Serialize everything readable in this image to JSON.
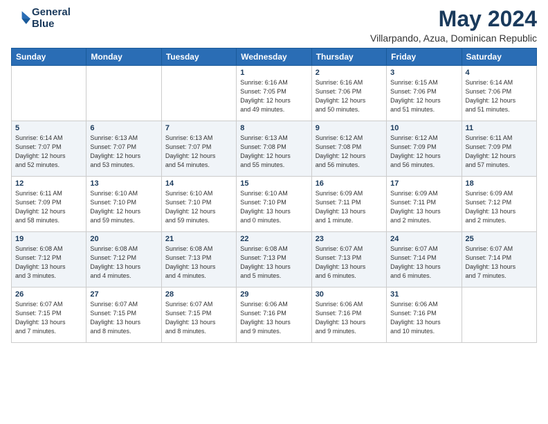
{
  "header": {
    "logo_line1": "General",
    "logo_line2": "Blue",
    "title": "May 2024",
    "subtitle": "Villarpando, Azua, Dominican Republic"
  },
  "weekdays": [
    "Sunday",
    "Monday",
    "Tuesday",
    "Wednesday",
    "Thursday",
    "Friday",
    "Saturday"
  ],
  "weeks": [
    [
      {
        "day": "",
        "info": ""
      },
      {
        "day": "",
        "info": ""
      },
      {
        "day": "",
        "info": ""
      },
      {
        "day": "1",
        "info": "Sunrise: 6:16 AM\nSunset: 7:05 PM\nDaylight: 12 hours\nand 49 minutes."
      },
      {
        "day": "2",
        "info": "Sunrise: 6:16 AM\nSunset: 7:06 PM\nDaylight: 12 hours\nand 50 minutes."
      },
      {
        "day": "3",
        "info": "Sunrise: 6:15 AM\nSunset: 7:06 PM\nDaylight: 12 hours\nand 51 minutes."
      },
      {
        "day": "4",
        "info": "Sunrise: 6:14 AM\nSunset: 7:06 PM\nDaylight: 12 hours\nand 51 minutes."
      }
    ],
    [
      {
        "day": "5",
        "info": "Sunrise: 6:14 AM\nSunset: 7:07 PM\nDaylight: 12 hours\nand 52 minutes."
      },
      {
        "day": "6",
        "info": "Sunrise: 6:13 AM\nSunset: 7:07 PM\nDaylight: 12 hours\nand 53 minutes."
      },
      {
        "day": "7",
        "info": "Sunrise: 6:13 AM\nSunset: 7:07 PM\nDaylight: 12 hours\nand 54 minutes."
      },
      {
        "day": "8",
        "info": "Sunrise: 6:13 AM\nSunset: 7:08 PM\nDaylight: 12 hours\nand 55 minutes."
      },
      {
        "day": "9",
        "info": "Sunrise: 6:12 AM\nSunset: 7:08 PM\nDaylight: 12 hours\nand 56 minutes."
      },
      {
        "day": "10",
        "info": "Sunrise: 6:12 AM\nSunset: 7:09 PM\nDaylight: 12 hours\nand 56 minutes."
      },
      {
        "day": "11",
        "info": "Sunrise: 6:11 AM\nSunset: 7:09 PM\nDaylight: 12 hours\nand 57 minutes."
      }
    ],
    [
      {
        "day": "12",
        "info": "Sunrise: 6:11 AM\nSunset: 7:09 PM\nDaylight: 12 hours\nand 58 minutes."
      },
      {
        "day": "13",
        "info": "Sunrise: 6:10 AM\nSunset: 7:10 PM\nDaylight: 12 hours\nand 59 minutes."
      },
      {
        "day": "14",
        "info": "Sunrise: 6:10 AM\nSunset: 7:10 PM\nDaylight: 12 hours\nand 59 minutes."
      },
      {
        "day": "15",
        "info": "Sunrise: 6:10 AM\nSunset: 7:10 PM\nDaylight: 13 hours\nand 0 minutes."
      },
      {
        "day": "16",
        "info": "Sunrise: 6:09 AM\nSunset: 7:11 PM\nDaylight: 13 hours\nand 1 minute."
      },
      {
        "day": "17",
        "info": "Sunrise: 6:09 AM\nSunset: 7:11 PM\nDaylight: 13 hours\nand 2 minutes."
      },
      {
        "day": "18",
        "info": "Sunrise: 6:09 AM\nSunset: 7:12 PM\nDaylight: 13 hours\nand 2 minutes."
      }
    ],
    [
      {
        "day": "19",
        "info": "Sunrise: 6:08 AM\nSunset: 7:12 PM\nDaylight: 13 hours\nand 3 minutes."
      },
      {
        "day": "20",
        "info": "Sunrise: 6:08 AM\nSunset: 7:12 PM\nDaylight: 13 hours\nand 4 minutes."
      },
      {
        "day": "21",
        "info": "Sunrise: 6:08 AM\nSunset: 7:13 PM\nDaylight: 13 hours\nand 4 minutes."
      },
      {
        "day": "22",
        "info": "Sunrise: 6:08 AM\nSunset: 7:13 PM\nDaylight: 13 hours\nand 5 minutes."
      },
      {
        "day": "23",
        "info": "Sunrise: 6:07 AM\nSunset: 7:13 PM\nDaylight: 13 hours\nand 6 minutes."
      },
      {
        "day": "24",
        "info": "Sunrise: 6:07 AM\nSunset: 7:14 PM\nDaylight: 13 hours\nand 6 minutes."
      },
      {
        "day": "25",
        "info": "Sunrise: 6:07 AM\nSunset: 7:14 PM\nDaylight: 13 hours\nand 7 minutes."
      }
    ],
    [
      {
        "day": "26",
        "info": "Sunrise: 6:07 AM\nSunset: 7:15 PM\nDaylight: 13 hours\nand 7 minutes."
      },
      {
        "day": "27",
        "info": "Sunrise: 6:07 AM\nSunset: 7:15 PM\nDaylight: 13 hours\nand 8 minutes."
      },
      {
        "day": "28",
        "info": "Sunrise: 6:07 AM\nSunset: 7:15 PM\nDaylight: 13 hours\nand 8 minutes."
      },
      {
        "day": "29",
        "info": "Sunrise: 6:06 AM\nSunset: 7:16 PM\nDaylight: 13 hours\nand 9 minutes."
      },
      {
        "day": "30",
        "info": "Sunrise: 6:06 AM\nSunset: 7:16 PM\nDaylight: 13 hours\nand 9 minutes."
      },
      {
        "day": "31",
        "info": "Sunrise: 6:06 AM\nSunset: 7:16 PM\nDaylight: 13 hours\nand 10 minutes."
      },
      {
        "day": "",
        "info": ""
      }
    ]
  ]
}
